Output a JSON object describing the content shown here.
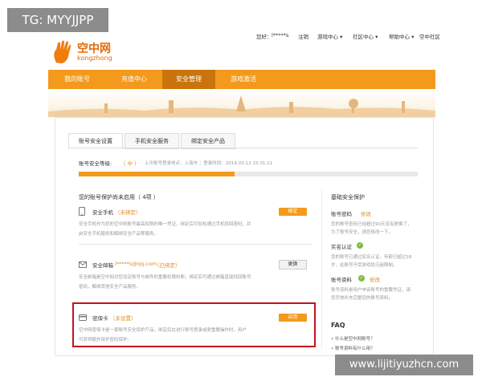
{
  "watermarks": {
    "tg": "TG: MYYJJPP",
    "site": "www.lijitiyuzhcn.com"
  },
  "logo": {
    "cn": "空中网",
    "en": "kongzhong"
  },
  "topnav": {
    "greeting": "您好：",
    "username": "l*****s",
    "items": [
      "注销",
      "游戏中心 ▾",
      "社区中心 ▾",
      "帮助中心 ▾",
      "空中社区"
    ]
  },
  "mainnav": {
    "items": [
      "我的账号",
      "充值中心",
      "安全管理",
      "游戏激活"
    ],
    "active_index": 2
  },
  "tabs": [
    "账号安全设置",
    "手机安全服务",
    "绑定安全产品"
  ],
  "security": {
    "label": "账号安全等级:",
    "level": "（ 中 ）",
    "last_login": "上次账号登录地点：上海市 ；登录时间：2014-03-12 15:31:11",
    "progress": 0.46
  },
  "section_title": "您的账号保护尚未启用（ 4项 ）",
  "items": [
    {
      "title": "安全手机",
      "status": "（未绑定）",
      "desc1": "安全手机作为您的空中网账号最高权限的唯一凭证，绑定后可轻松通过手机找回密码，并",
      "desc2": "启安全手机服务和解绑安全产品等服务。",
      "button": "绑定"
    },
    {
      "title": "安全邮箱",
      "email": "l*****s@qq.com",
      "status": "（已绑定）",
      "desc1": "安全邮箱是空中网对您设定账号与邮件的重要权限判断，绑定后可通过邮箱直接找回账号",
      "desc2": "密码，解绑其他安全产品服务。",
      "button": "更换"
    },
    {
      "title": "密保卡",
      "status": "（未设置）",
      "desc1": "空中网密保卡是一套账号安全保护产品，绑定后在进行账号登录或更重要操作时，用户",
      "desc2": "可获得额外保护密码保护。",
      "button": "启用"
    }
  ],
  "sidebar": {
    "title": "基础安全保护",
    "items": [
      {
        "title": "账号密码",
        "action": "修改",
        "desc1": "您的账号密码已经超过90天没有更换了，",
        "desc2": "为了账号安全，请您修改一下。"
      },
      {
        "title": "实名认证",
        "desc1": "您的账号已通过实名认证，年龄已超过18",
        "desc2": "岁，此账号不受游戏防沉迷限制。"
      },
      {
        "title": "账号资料",
        "action": "修改",
        "desc1": "账号资料是用户申诉账号的重要凭证，请",
        "desc2": "您尽快补充完整您的账号资料。"
      }
    ]
  },
  "faq": {
    "title": "FAQ",
    "items": [
      "什么是空中网账号？",
      "账号资料有什么用？"
    ]
  },
  "colors": {
    "orange": "#f39a1d",
    "dark_orange": "#c9740c",
    "red_frame": "#c0121e",
    "green_check": "#7bbf3a"
  }
}
